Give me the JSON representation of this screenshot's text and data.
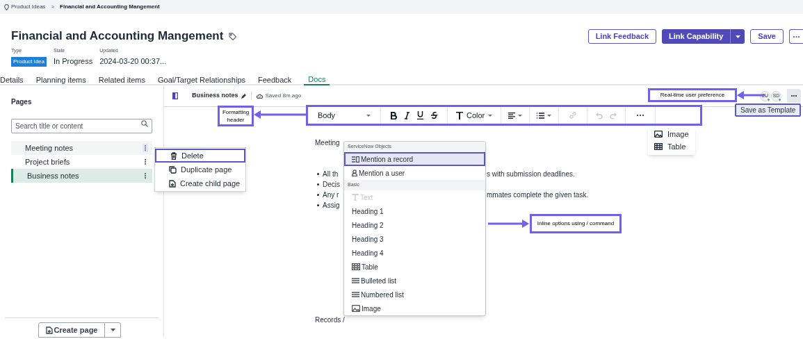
{
  "breadcrumb": [
    {
      "label": "Product Ideas",
      "kind": "root"
    },
    {
      "label": ">",
      "kind": "separator"
    },
    {
      "label": "Financial and Accounting Mangement",
      "kind": "current"
    }
  ],
  "record": {
    "title": "Financial and Accounting Mangement",
    "fields": [
      {
        "label": "Type",
        "value": "Product idea",
        "kind": "badge"
      },
      {
        "label": "State",
        "value": "In Progress",
        "kind": "text"
      },
      {
        "label": "Updated",
        "value": "2024-03-20 00:37...",
        "kind": "text"
      }
    ]
  },
  "actions": [
    {
      "label": "Link Feedback",
      "kind": "outline"
    },
    {
      "label": "Link Capability",
      "kind": "split"
    },
    {
      "label": "Save",
      "kind": "outline"
    },
    {
      "kind": "more"
    }
  ],
  "tabs": [
    {
      "label": "Details",
      "selected": false
    },
    {
      "label": "Planning items",
      "selected": false
    },
    {
      "label": "Related items",
      "selected": false
    },
    {
      "label": "Goal/Target Relationships",
      "selected": false
    },
    {
      "label": "Feedback",
      "selected": false
    },
    {
      "label": "Docs",
      "selected": true
    }
  ],
  "pages_panel": {
    "title": "Pages",
    "search": {
      "placeholder": "Search title or content"
    },
    "items": [
      {
        "label": "Meeting notes",
        "selected": false,
        "hovered": true
      },
      {
        "label": "Project briefs",
        "selected": false,
        "hovered": false
      },
      {
        "label": "Business notes",
        "selected": true,
        "hovered": false
      }
    ],
    "context_menu": [
      {
        "label": "Delete",
        "highlighted": true
      },
      {
        "label": "Duplicate page",
        "highlighted": false
      },
      {
        "label": "Create child page",
        "highlighted": false
      }
    ],
    "create_button": "Create page"
  },
  "editor": {
    "doc_title": "Business notes",
    "saved": "Saved 8m ago",
    "presence": [
      {
        "initials": "2U"
      },
      {
        "initials": "SD"
      }
    ],
    "tooltip": "Save as Template",
    "toolbar": {
      "style": "Body",
      "color_label": "Color"
    },
    "more_menu": [
      {
        "label": "Image"
      },
      {
        "label": "Table"
      }
    ],
    "content": [
      {
        "kind": "paragraph",
        "text": "Meeting"
      },
      {
        "kind": "bullet",
        "text": "All th",
        "text_right": "s with submission deadlines."
      },
      {
        "kind": "bullet",
        "text": "Decis"
      },
      {
        "kind": "bullet",
        "text": "Any r",
        "text_right": "mmates complete the given task."
      },
      {
        "kind": "bullet",
        "text": "Assig"
      },
      {
        "kind": "paragraph",
        "text": "Records /"
      }
    ],
    "slash_menu": [
      {
        "title": "ServiceNow Objects",
        "items": [
          {
            "label": "Mention a record",
            "highlighted": true,
            "disabled": false
          },
          {
            "label": "Mention a user",
            "highlighted": false,
            "disabled": false
          }
        ]
      },
      {
        "title": "Basic",
        "items": [
          {
            "label": "Text",
            "highlighted": false,
            "disabled": true
          },
          {
            "label": "Heading 1",
            "highlighted": false,
            "disabled": false
          },
          {
            "label": "Heading 2",
            "highlighted": false,
            "disabled": false
          },
          {
            "label": "Heading 3",
            "highlighted": false,
            "disabled": false
          },
          {
            "label": "Heading 4",
            "highlighted": false,
            "disabled": false
          },
          {
            "label": "Table",
            "highlighted": false,
            "disabled": false
          },
          {
            "label": "Bulleted list",
            "highlighted": false,
            "disabled": false
          },
          {
            "label": "Numbered list",
            "highlighted": false,
            "disabled": false
          },
          {
            "label": "Image",
            "highlighted": false,
            "disabled": false
          }
        ]
      }
    ]
  },
  "annotations": [
    {
      "kind": "presence",
      "text": "Real-time user preference"
    },
    {
      "kind": "toolbar",
      "text": "Formatting header"
    },
    {
      "kind": "slash",
      "text": "Inline options using / command"
    }
  ]
}
